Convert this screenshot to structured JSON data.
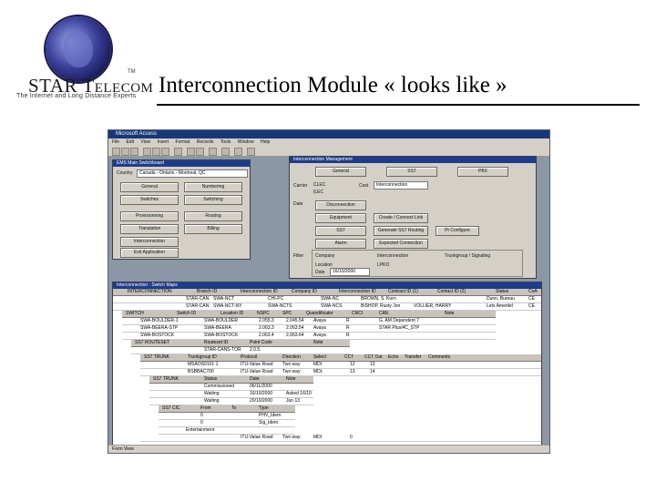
{
  "logo": {
    "name_first": "STAR T",
    "name_second_small": "ELECOM",
    "trademark": "TM",
    "tagline": "The Internet and Long Distance Experts"
  },
  "slide_title": "Interconnection Module « looks like »",
  "app": {
    "title": "Microsoft Access",
    "menu": [
      "File",
      "Edit",
      "View",
      "Insert",
      "Format",
      "Records",
      "Tools",
      "Window",
      "Help"
    ],
    "status": "Form View"
  },
  "switchboard": {
    "title": "EMS Main Switchboard",
    "region_label": "Country",
    "region_value": "Canada - Ontario - Montreal, QC",
    "buttons": [
      "General",
      "Numbering",
      "Switches",
      "Switching",
      "Provisionning",
      "Routing",
      "Translation",
      "Billing",
      "Interconnection",
      "Exit Application"
    ]
  },
  "interconnect_panel": {
    "title": "Interconnection Management",
    "tabs": [
      "General",
      "SS7",
      "PBX"
    ],
    "carrier_label": "Carrier",
    "carrier_radios": [
      "CLEC",
      "ILEC"
    ],
    "cost_label": "Cost",
    "cost_value": "Interconnection",
    "date_label": "Date",
    "date_button": "Disconnection",
    "buttons": [
      "Equipment",
      "Create / Connect Link",
      "SS7",
      "Generate SS7 Routing",
      "Pt Configure",
      "Alarm",
      "Expected Connection"
    ],
    "filter_label": "Filter",
    "filter_options": [
      "Company",
      "Interconnection",
      "Trunkgroup / Signaling",
      "Location",
      "LPKO"
    ],
    "date_field_label": "Date",
    "date_field_value": "16/10/2000"
  },
  "detail_window": {
    "title": "Interconnection : Switch Maps",
    "level1_headers": [
      "INTERCONNECTION",
      "Branch ID",
      "Interconnection ID",
      "Company ID",
      "Interconnection ID",
      "Contract ID (1)",
      "Contact ID (2)",
      "Status",
      "CoA"
    ],
    "level1_rows": [
      [
        "STAR-CAN",
        "SWA-NCT",
        "CHI-PC",
        "SWA-NC",
        "BROWN, S. Korn",
        "",
        "Dunn, Bureau",
        "CE"
      ],
      [
        "STAR-CAN",
        "SWA-NCT-NY",
        "SWA-NCTS",
        "SWA-NCS",
        "BISHOP, Rusty Jon",
        "VOLLIER, HARRY",
        "Lets Ameritel",
        "CE"
      ]
    ],
    "level2_headers": [
      "SWITCH",
      "Switch ID",
      "Location ID",
      "NSPC",
      "SPC",
      "Quandificator",
      "CRCI",
      "CRE",
      "Note"
    ],
    "level2_rows": [
      [
        "SWA-BOULDER-1",
        "SWA-BOULDER",
        "2.055.3",
        "2.045.54",
        "Avaya",
        "R",
        "G. AM Dependent 7",
        ""
      ],
      [
        "SWA-BEERA-STP",
        "SWA-BEERA",
        "2.063.3",
        "2.063.54",
        "Avaya",
        "R",
        "STAR Plus/4C_STP",
        ""
      ],
      [
        "SWA-BOSTOCK",
        "SWA-BOSTOCK",
        "2.063.4",
        "2.063.64",
        "Avaya",
        "R",
        "",
        ""
      ]
    ],
    "level3_headers": [
      "SS7 ROUTESET",
      "Routeset ID",
      "Point Code",
      "Note"
    ],
    "level3_rows": [
      [
        "",
        "STAR-CANS-TOR",
        "2.0.5.",
        ""
      ]
    ],
    "level4_headers": [
      "SS7 TRUNK",
      "Trunkgroup ID",
      "Protocol",
      "Direction",
      "Select",
      "CCT",
      "CCT Out",
      "Echo",
      "Transfer",
      "Comments"
    ],
    "level4_rows": [
      [
        "",
        "MSAOS0101 1",
        "ITU-Value Road",
        "Two way",
        "MDI",
        "12",
        "13",
        "",
        "",
        ""
      ],
      [
        "",
        "BSBBAC700",
        "ITU-Value Road",
        "Two way",
        "MDL",
        "13",
        "14",
        "",
        "",
        ""
      ]
    ],
    "level5_headers": [
      "SS7 TRUNK",
      "Status",
      "Date",
      "Note"
    ],
    "level5_rows": [
      [
        "",
        "Commissioned",
        "06/11/2000",
        ""
      ],
      [
        "",
        "Waiting",
        "16/10/2000",
        "Asked 16/10"
      ],
      [
        "",
        "Waiting",
        "20/10/2000",
        "Jun 13"
      ]
    ],
    "level6_headers": [
      "SS7 CIC",
      "From",
      "To",
      "Type"
    ],
    "level6_rows": [
      [
        "",
        "0",
        "",
        "PHV_Idem"
      ],
      [
        "",
        "0",
        "",
        "Sig_Idem"
      ],
      [
        "",
        "Entertainment",
        "",
        ""
      ]
    ],
    "tail_rows": [
      [
        "",
        "ITU-Value Road",
        "Two way",
        "MDI",
        "0",
        "",
        "",
        ""
      ],
      [
        "",
        "NSPC",
        "",
        "",
        "",
        "",
        "",
        ""
      ],
      [
        "SWA-BEERA-STP",
        "SWA-BEERA",
        "2.063.3",
        "Avaya",
        "",
        "STAR Plus 4C_STP",
        ""
      ],
      [
        "",
        "",
        "",
        "",
        "",
        "",
        "",
        ""
      ]
    ]
  }
}
